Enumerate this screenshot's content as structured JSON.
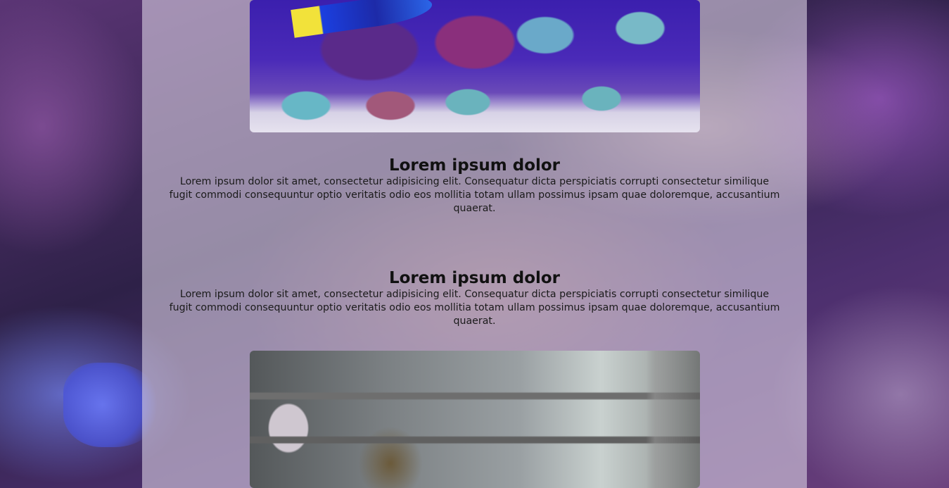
{
  "sections": [
    {
      "title": "Lorem ipsum dolor",
      "body": "Lorem ipsum dolor sit amet, consectetur adipisicing elit. Consequatur dicta perspiciatis corrupti consectetur similique fugit commodi consequuntur optio veritatis odio eos mollitia totam ullam possimus ipsam quae doloremque, accusantium quaerat."
    },
    {
      "title": "Lorem ipsum dolor",
      "body": "Lorem ipsum dolor sit amet, consectetur adipisicing elit. Consequatur dicta perspiciatis corrupti consectetur similique fugit commodi consequuntur optio veritatis odio eos mollitia totam ullam possimus ipsam quae doloremque, accusantium quaerat."
    }
  ],
  "images": [
    {
      "name": "reef-aquarium-photo"
    },
    {
      "name": "planted-aquarium-photo"
    }
  ],
  "colors": {
    "column_overlay": "#d7cde1",
    "text": "#111111"
  }
}
